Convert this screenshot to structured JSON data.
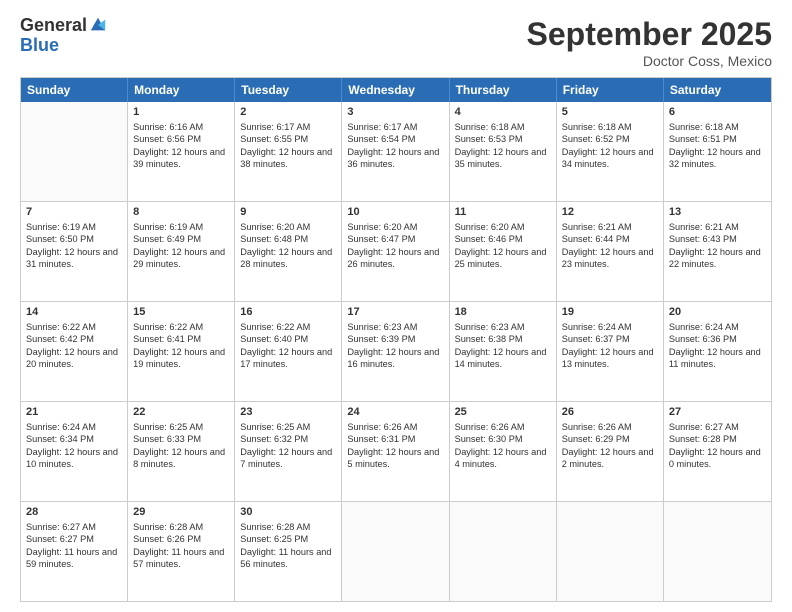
{
  "logo": {
    "general": "General",
    "blue": "Blue"
  },
  "title": "September 2025",
  "subtitle": "Doctor Coss, Mexico",
  "days": [
    "Sunday",
    "Monday",
    "Tuesday",
    "Wednesday",
    "Thursday",
    "Friday",
    "Saturday"
  ],
  "weeks": [
    [
      {
        "num": "",
        "sunrise": "",
        "sunset": "",
        "daylight": ""
      },
      {
        "num": "1",
        "sunrise": "Sunrise: 6:16 AM",
        "sunset": "Sunset: 6:56 PM",
        "daylight": "Daylight: 12 hours and 39 minutes."
      },
      {
        "num": "2",
        "sunrise": "Sunrise: 6:17 AM",
        "sunset": "Sunset: 6:55 PM",
        "daylight": "Daylight: 12 hours and 38 minutes."
      },
      {
        "num": "3",
        "sunrise": "Sunrise: 6:17 AM",
        "sunset": "Sunset: 6:54 PM",
        "daylight": "Daylight: 12 hours and 36 minutes."
      },
      {
        "num": "4",
        "sunrise": "Sunrise: 6:18 AM",
        "sunset": "Sunset: 6:53 PM",
        "daylight": "Daylight: 12 hours and 35 minutes."
      },
      {
        "num": "5",
        "sunrise": "Sunrise: 6:18 AM",
        "sunset": "Sunset: 6:52 PM",
        "daylight": "Daylight: 12 hours and 34 minutes."
      },
      {
        "num": "6",
        "sunrise": "Sunrise: 6:18 AM",
        "sunset": "Sunset: 6:51 PM",
        "daylight": "Daylight: 12 hours and 32 minutes."
      }
    ],
    [
      {
        "num": "7",
        "sunrise": "Sunrise: 6:19 AM",
        "sunset": "Sunset: 6:50 PM",
        "daylight": "Daylight: 12 hours and 31 minutes."
      },
      {
        "num": "8",
        "sunrise": "Sunrise: 6:19 AM",
        "sunset": "Sunset: 6:49 PM",
        "daylight": "Daylight: 12 hours and 29 minutes."
      },
      {
        "num": "9",
        "sunrise": "Sunrise: 6:20 AM",
        "sunset": "Sunset: 6:48 PM",
        "daylight": "Daylight: 12 hours and 28 minutes."
      },
      {
        "num": "10",
        "sunrise": "Sunrise: 6:20 AM",
        "sunset": "Sunset: 6:47 PM",
        "daylight": "Daylight: 12 hours and 26 minutes."
      },
      {
        "num": "11",
        "sunrise": "Sunrise: 6:20 AM",
        "sunset": "Sunset: 6:46 PM",
        "daylight": "Daylight: 12 hours and 25 minutes."
      },
      {
        "num": "12",
        "sunrise": "Sunrise: 6:21 AM",
        "sunset": "Sunset: 6:44 PM",
        "daylight": "Daylight: 12 hours and 23 minutes."
      },
      {
        "num": "13",
        "sunrise": "Sunrise: 6:21 AM",
        "sunset": "Sunset: 6:43 PM",
        "daylight": "Daylight: 12 hours and 22 minutes."
      }
    ],
    [
      {
        "num": "14",
        "sunrise": "Sunrise: 6:22 AM",
        "sunset": "Sunset: 6:42 PM",
        "daylight": "Daylight: 12 hours and 20 minutes."
      },
      {
        "num": "15",
        "sunrise": "Sunrise: 6:22 AM",
        "sunset": "Sunset: 6:41 PM",
        "daylight": "Daylight: 12 hours and 19 minutes."
      },
      {
        "num": "16",
        "sunrise": "Sunrise: 6:22 AM",
        "sunset": "Sunset: 6:40 PM",
        "daylight": "Daylight: 12 hours and 17 minutes."
      },
      {
        "num": "17",
        "sunrise": "Sunrise: 6:23 AM",
        "sunset": "Sunset: 6:39 PM",
        "daylight": "Daylight: 12 hours and 16 minutes."
      },
      {
        "num": "18",
        "sunrise": "Sunrise: 6:23 AM",
        "sunset": "Sunset: 6:38 PM",
        "daylight": "Daylight: 12 hours and 14 minutes."
      },
      {
        "num": "19",
        "sunrise": "Sunrise: 6:24 AM",
        "sunset": "Sunset: 6:37 PM",
        "daylight": "Daylight: 12 hours and 13 minutes."
      },
      {
        "num": "20",
        "sunrise": "Sunrise: 6:24 AM",
        "sunset": "Sunset: 6:36 PM",
        "daylight": "Daylight: 12 hours and 11 minutes."
      }
    ],
    [
      {
        "num": "21",
        "sunrise": "Sunrise: 6:24 AM",
        "sunset": "Sunset: 6:34 PM",
        "daylight": "Daylight: 12 hours and 10 minutes."
      },
      {
        "num": "22",
        "sunrise": "Sunrise: 6:25 AM",
        "sunset": "Sunset: 6:33 PM",
        "daylight": "Daylight: 12 hours and 8 minutes."
      },
      {
        "num": "23",
        "sunrise": "Sunrise: 6:25 AM",
        "sunset": "Sunset: 6:32 PM",
        "daylight": "Daylight: 12 hours and 7 minutes."
      },
      {
        "num": "24",
        "sunrise": "Sunrise: 6:26 AM",
        "sunset": "Sunset: 6:31 PM",
        "daylight": "Daylight: 12 hours and 5 minutes."
      },
      {
        "num": "25",
        "sunrise": "Sunrise: 6:26 AM",
        "sunset": "Sunset: 6:30 PM",
        "daylight": "Daylight: 12 hours and 4 minutes."
      },
      {
        "num": "26",
        "sunrise": "Sunrise: 6:26 AM",
        "sunset": "Sunset: 6:29 PM",
        "daylight": "Daylight: 12 hours and 2 minutes."
      },
      {
        "num": "27",
        "sunrise": "Sunrise: 6:27 AM",
        "sunset": "Sunset: 6:28 PM",
        "daylight": "Daylight: 12 hours and 0 minutes."
      }
    ],
    [
      {
        "num": "28",
        "sunrise": "Sunrise: 6:27 AM",
        "sunset": "Sunset: 6:27 PM",
        "daylight": "Daylight: 11 hours and 59 minutes."
      },
      {
        "num": "29",
        "sunrise": "Sunrise: 6:28 AM",
        "sunset": "Sunset: 6:26 PM",
        "daylight": "Daylight: 11 hours and 57 minutes."
      },
      {
        "num": "30",
        "sunrise": "Sunrise: 6:28 AM",
        "sunset": "Sunset: 6:25 PM",
        "daylight": "Daylight: 11 hours and 56 minutes."
      },
      {
        "num": "",
        "sunrise": "",
        "sunset": "",
        "daylight": ""
      },
      {
        "num": "",
        "sunrise": "",
        "sunset": "",
        "daylight": ""
      },
      {
        "num": "",
        "sunrise": "",
        "sunset": "",
        "daylight": ""
      },
      {
        "num": "",
        "sunrise": "",
        "sunset": "",
        "daylight": ""
      }
    ]
  ]
}
